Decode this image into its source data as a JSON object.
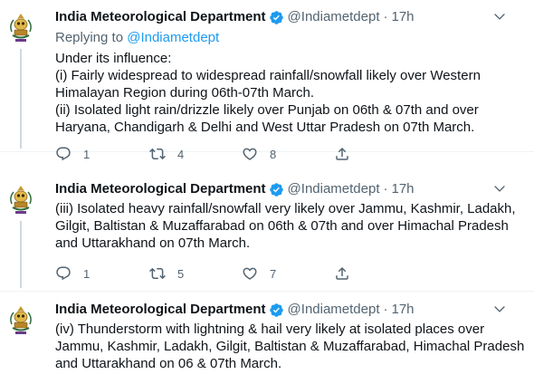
{
  "tweets": [
    {
      "author": "India Meteorological Department",
      "handle": "@Indiametdept",
      "separator": "·",
      "time": "17h",
      "replying_label": "Replying to",
      "replying_handle": "@Indiametdept",
      "lines": [
        "Under its influence:",
        "(i) Fairly widespread to widespread rainfall/snowfall likely over Western",
        "Himalayan Region during 06th-07th March.",
        "(ii) Isolated light rain/drizzle likely over Punjab on 06th & 07th and over",
        "Haryana, Chandigarh & Delhi and West Uttar Pradesh on 07th March."
      ],
      "replies": "1",
      "retweets": "4",
      "likes": "8"
    },
    {
      "author": "India Meteorological Department",
      "handle": "@Indiametdept",
      "separator": "·",
      "time": "17h",
      "lines": [
        "(iii) Isolated heavy rainfall/snowfall very likely over Jammu, Kashmir, Ladakh,",
        "Gilgit, Baltistan & Muzaffarabad on 06th & 07th and over Himachal Pradesh",
        "and Uttarakhand on 07th March."
      ],
      "replies": "1",
      "retweets": "5",
      "likes": "7"
    },
    {
      "author": "India Meteorological Department",
      "handle": "@Indiametdept",
      "separator": "·",
      "time": "17h",
      "lines": [
        "(iv) Thunderstorm with lightning & hail very likely at isolated places over",
        "Jammu, Kashmir, Ladakh, Gilgit, Baltistan & Muzaffarabad, Himachal Pradesh",
        "and Uttarakhand on 06 & 07th March."
      ]
    }
  ],
  "colors": {
    "text": "#0f1419",
    "secondary": "#536471",
    "link": "#1d9bf0",
    "verified": "#1d9bf0",
    "divider": "#eff3f4"
  }
}
